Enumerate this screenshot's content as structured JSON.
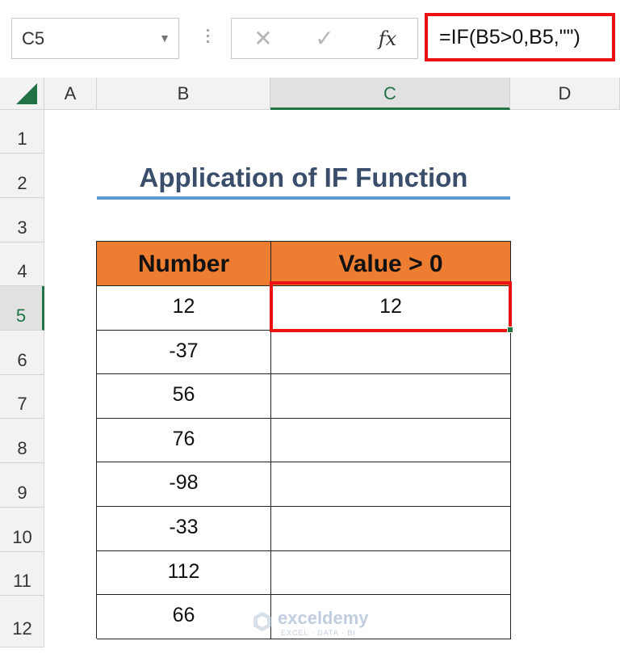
{
  "formula_bar": {
    "name_box": "C5",
    "cancel_icon": "✕",
    "enter_icon": "✓",
    "fx_label": "fx",
    "formula": "=IF(B5>0,B5,\"\")"
  },
  "columns": [
    "A",
    "B",
    "C",
    "D"
  ],
  "active_column": "C",
  "rows": [
    "1",
    "2",
    "3",
    "4",
    "5",
    "6",
    "7",
    "8",
    "9",
    "10",
    "11",
    "12"
  ],
  "active_row": "5",
  "title": "Application of IF Function",
  "table": {
    "headers": [
      "Number",
      "Value > 0"
    ],
    "rows": [
      [
        "12",
        "12"
      ],
      [
        "-37",
        ""
      ],
      [
        "56",
        ""
      ],
      [
        "76",
        ""
      ],
      [
        "-98",
        ""
      ],
      [
        "-33",
        ""
      ],
      [
        "112",
        ""
      ],
      [
        "66",
        ""
      ]
    ]
  },
  "colors": {
    "header_fill": "#ed7d31",
    "selection_border": "#ee1111",
    "title_underline": "#5b9bd5",
    "excel_green": "#217346"
  },
  "watermark": {
    "name": "exceldemy",
    "tagline": "EXCEL · DATA · BI"
  }
}
